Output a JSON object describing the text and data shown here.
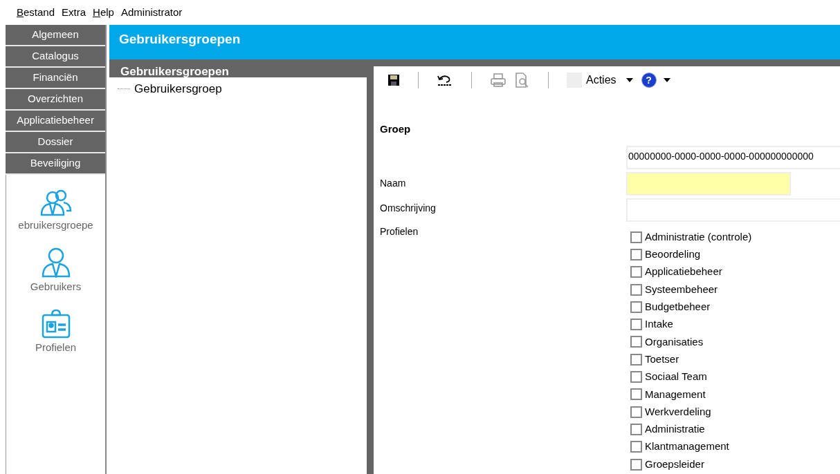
{
  "menu": [
    {
      "label": "Bestand",
      "mnemonic": true
    },
    {
      "label": "Extra",
      "mnemonic": false
    },
    {
      "label": "Help",
      "mnemonic": true
    },
    {
      "label": "Administrator",
      "mnemonic": false
    }
  ],
  "modules": [
    {
      "label": "Algemeen"
    },
    {
      "label": "Catalogus"
    },
    {
      "label": "Financiën"
    },
    {
      "label": "Overzichten"
    },
    {
      "label": "Applicatiebeheer"
    },
    {
      "label": "Dossier"
    },
    {
      "label": "Beveiliging"
    }
  ],
  "module_items": [
    {
      "kind": "group",
      "label": "ebruikersgroepe"
    },
    {
      "kind": "user",
      "label": "Gebruikers"
    },
    {
      "kind": "badge",
      "label": "Profielen"
    }
  ],
  "header": {
    "title": "Gebruikersgroepen"
  },
  "tree": {
    "title": "Gebruikersgroepen",
    "items": [
      {
        "label": "Gebruikersgroep"
      }
    ]
  },
  "toolbar": {
    "actions_label": "Acties",
    "help_glyph": "?"
  },
  "form": {
    "section": "Groep",
    "id_value": "00000000-0000-0000-0000-000000000000",
    "name_label": "Naam",
    "description_label": "Omschrijving",
    "profiles_label": "Profielen",
    "profiles": [
      {
        "label": "Administratie (controle)",
        "checked": false
      },
      {
        "label": "Beoordeling",
        "checked": false
      },
      {
        "label": "Applicatiebeheer",
        "checked": false
      },
      {
        "label": "Systeembeheer",
        "checked": false
      },
      {
        "label": "Budgetbeheer",
        "checked": false
      },
      {
        "label": "Intake",
        "checked": false
      },
      {
        "label": "Organisaties",
        "checked": false
      },
      {
        "label": "Toetser",
        "checked": false
      },
      {
        "label": "Sociaal Team",
        "checked": false
      },
      {
        "label": "Management",
        "checked": false
      },
      {
        "label": "Werkverdeling",
        "checked": false
      },
      {
        "label": "Administratie",
        "checked": false
      },
      {
        "label": "Klantmanagement",
        "checked": false
      },
      {
        "label": "Groepsleider",
        "checked": false
      }
    ]
  }
}
